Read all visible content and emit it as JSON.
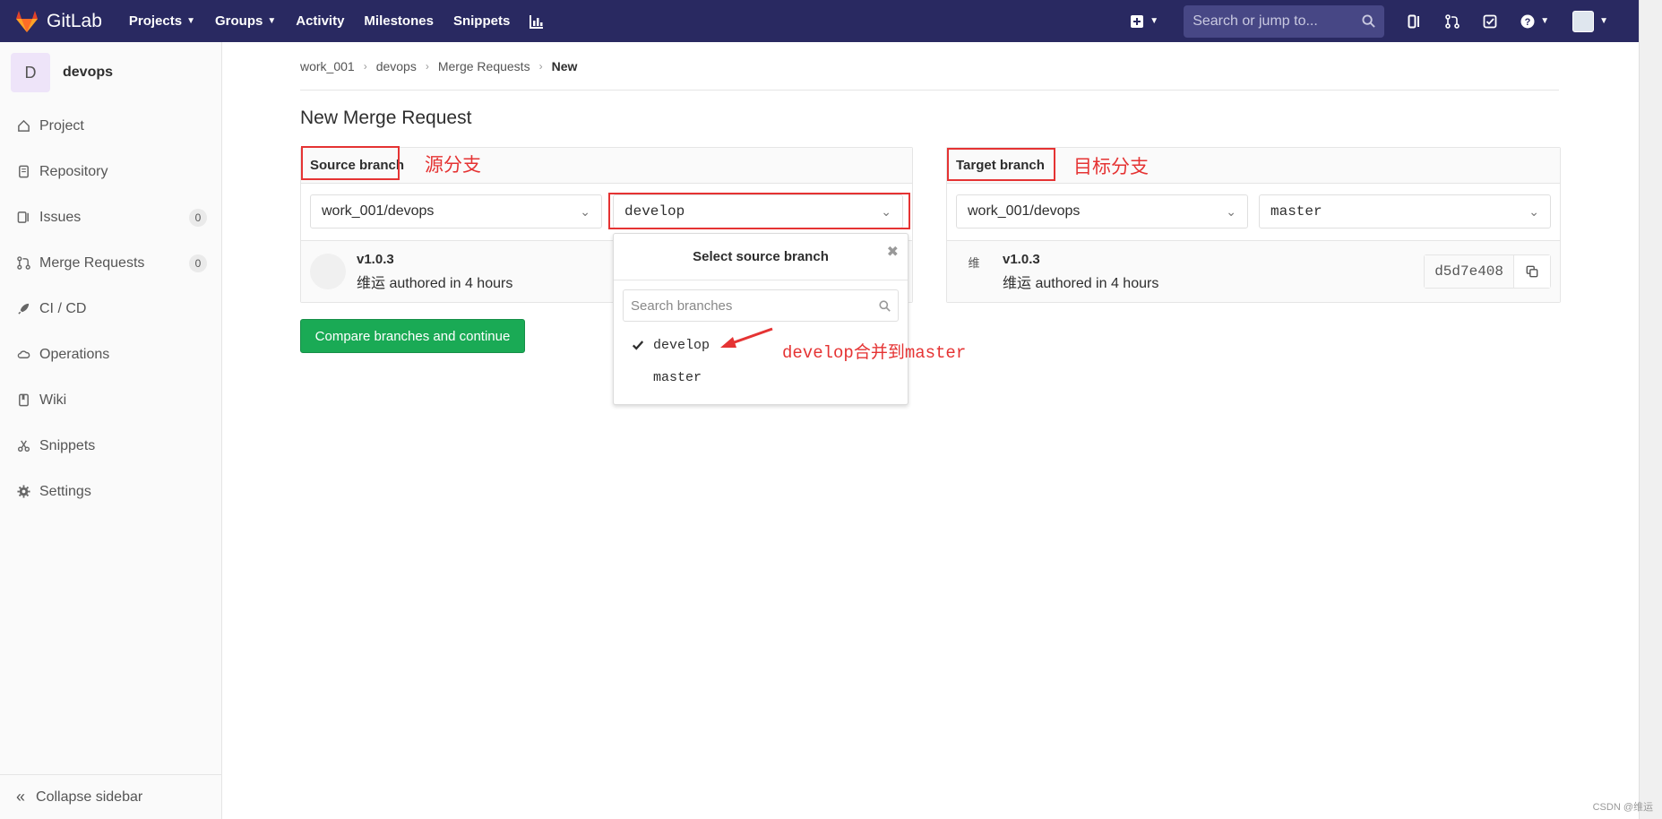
{
  "topnav": {
    "brand": "GitLab",
    "links": [
      {
        "label": "Projects",
        "caret": true
      },
      {
        "label": "Groups",
        "caret": true
      },
      {
        "label": "Activity",
        "caret": false
      },
      {
        "label": "Milestones",
        "caret": false
      },
      {
        "label": "Snippets",
        "caret": false
      }
    ],
    "search_placeholder": "Search or jump to..."
  },
  "sidebar": {
    "project_initial": "D",
    "project_name": "devops",
    "items": [
      {
        "label": "Project",
        "icon": "home-icon",
        "count": ""
      },
      {
        "label": "Repository",
        "icon": "doc-icon",
        "count": ""
      },
      {
        "label": "Issues",
        "icon": "issues-icon",
        "count": "0"
      },
      {
        "label": "Merge Requests",
        "icon": "merge-request-icon",
        "count": "0"
      },
      {
        "label": "CI / CD",
        "icon": "rocket-icon",
        "count": ""
      },
      {
        "label": "Operations",
        "icon": "cloud-gear-icon",
        "count": ""
      },
      {
        "label": "Wiki",
        "icon": "book-icon",
        "count": ""
      },
      {
        "label": "Snippets",
        "icon": "scissors-icon",
        "count": ""
      },
      {
        "label": "Settings",
        "icon": "gear-icon",
        "count": ""
      }
    ],
    "collapse_label": "Collapse sidebar"
  },
  "breadcrumb": [
    "work_001",
    "devops",
    "Merge Requests",
    "New"
  ],
  "page_title": "New Merge Request",
  "source": {
    "header": "Source branch",
    "annotation": "源分支",
    "project": "work_001/devops",
    "branch": "develop",
    "commit_title": "v1.0.3",
    "commit_author_line": "维运 authored in 4 hours"
  },
  "target": {
    "header": "Target branch",
    "annotation": "目标分支",
    "project": "work_001/devops",
    "branch": "master",
    "avatar_alt": "维",
    "commit_title": "v1.0.3",
    "commit_author_line": "维运 authored in 4 hours",
    "sha": "d5d7e408"
  },
  "compare_button": "Compare branches and continue",
  "dropdown": {
    "title": "Select source branch",
    "search_placeholder": "Search branches",
    "items": [
      {
        "label": "develop",
        "selected": true
      },
      {
        "label": "master",
        "selected": false
      }
    ]
  },
  "arrow_annotation": "develop合并到master",
  "watermark": "CSDN @维运",
  "colors": {
    "nav_bg": "#292961",
    "annotation_red": "#e53333",
    "button_green": "#1aaa55"
  }
}
